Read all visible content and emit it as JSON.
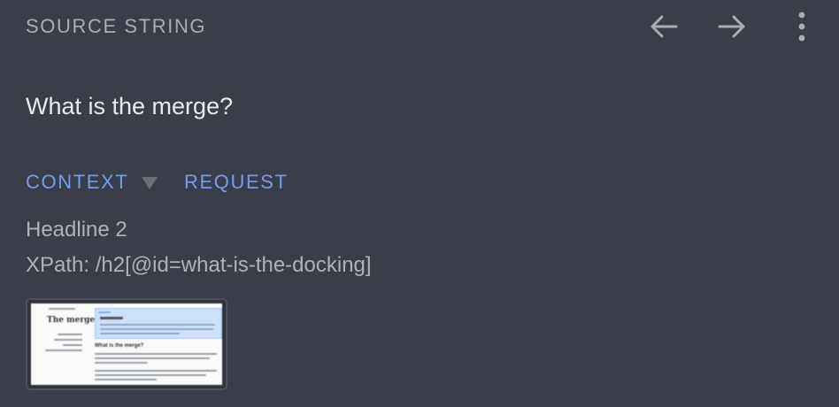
{
  "header": {
    "title": "SOURCE STRING",
    "prev_icon": "arrow-left-icon",
    "next_icon": "arrow-right-icon",
    "more_icon": "more-vertical-icon"
  },
  "source": {
    "text": "What is the merge?"
  },
  "tabs": [
    {
      "label": "CONTEXT",
      "has_dropdown": true
    },
    {
      "label": "REQUEST",
      "has_dropdown": false
    }
  ],
  "context": {
    "kind": "Headline 2",
    "xpath": "XPath: /h2[@id=what-is-the-docking]"
  },
  "thumbnail": {
    "left_title": "The merge",
    "section_heading": "What is the merge?"
  },
  "colors": {
    "background": "#393e48",
    "accent": "#6f9df0",
    "muted_text": "#aeb2ba"
  }
}
